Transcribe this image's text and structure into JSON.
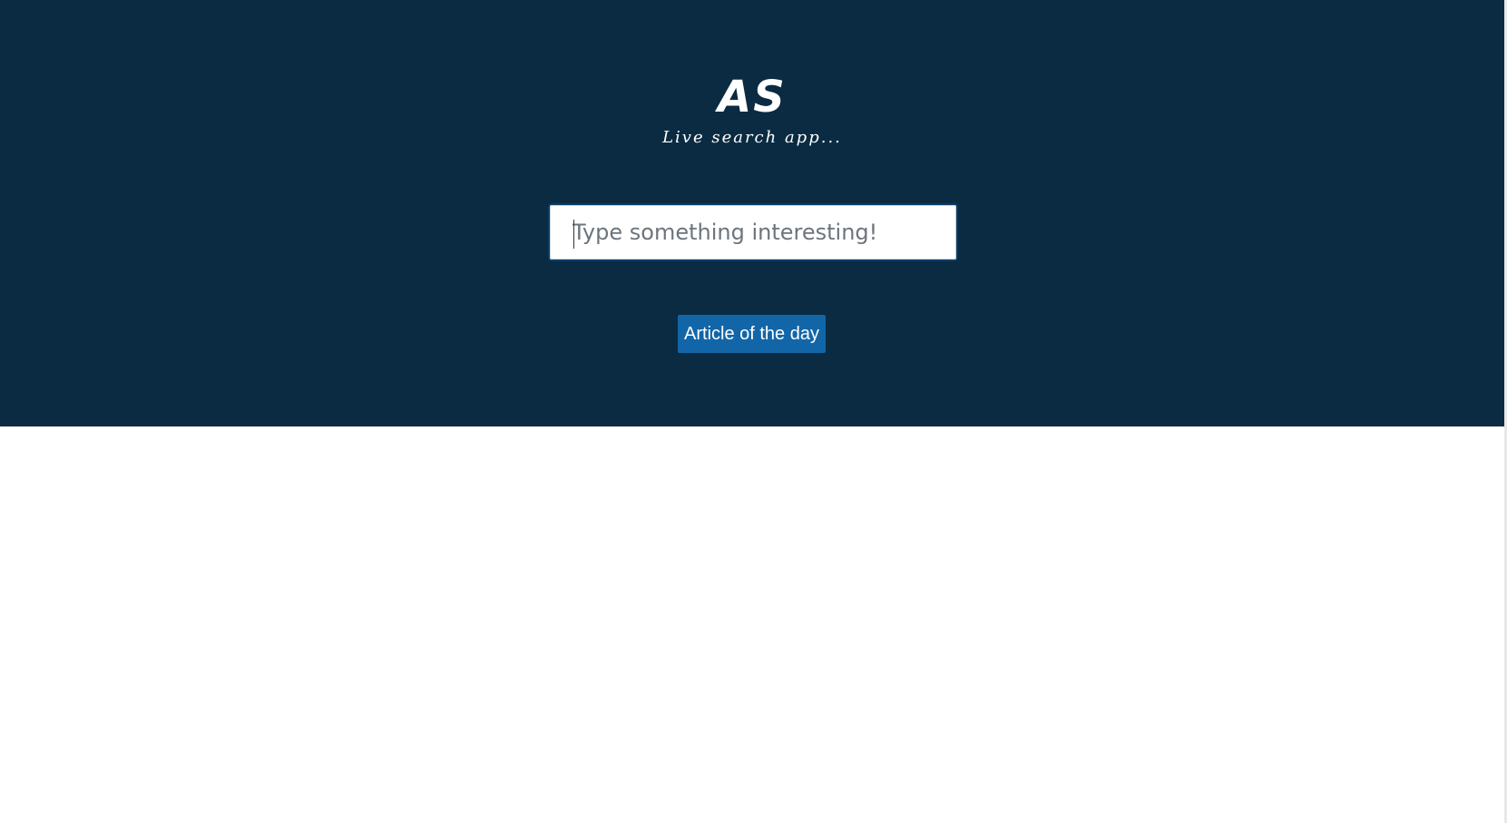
{
  "header": {
    "title": "AS",
    "subtitle": "Live search app..."
  },
  "search": {
    "placeholder": "Type something interesting!",
    "value": ""
  },
  "actions": {
    "article_button_label": "Article of the day"
  },
  "colors": {
    "hero_background": "#0a2b42",
    "button_background": "#1266a8",
    "page_background": "#ffffff"
  }
}
